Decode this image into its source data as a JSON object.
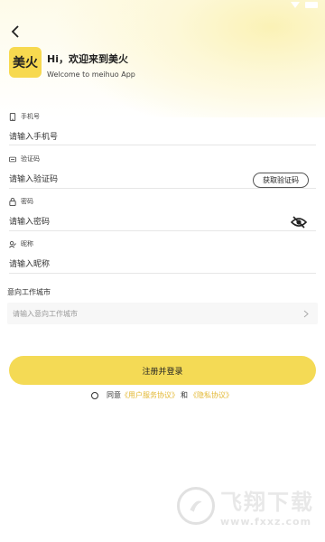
{
  "header": {
    "logo_text": "美火",
    "greeting": "Hi，欢迎来到美火",
    "subtitle": "Welcome to meihuo App"
  },
  "fields": {
    "phone": {
      "label": "手机号",
      "placeholder": "请输入手机号"
    },
    "code": {
      "label": "验证码",
      "placeholder": "请输入验证码",
      "button": "获取验证码"
    },
    "password": {
      "label": "密码",
      "placeholder": "请输入密码"
    },
    "nickname": {
      "label": "昵称",
      "placeholder": "请输入昵称"
    },
    "city": {
      "label": "意向工作城市",
      "placeholder": "请输入意向工作城市"
    }
  },
  "submit_label": "注册并登录",
  "agreement": {
    "prefix": "同意",
    "user_agreement": "《用户服务协议》",
    "and": "和",
    "privacy": "《隐私协议》"
  },
  "watermark": {
    "title": "飞翔下载",
    "url": "www.fxxz.com"
  },
  "colors": {
    "accent": "#f4da55",
    "link": "#e3b834",
    "logo_bg": "#f7d94f"
  }
}
